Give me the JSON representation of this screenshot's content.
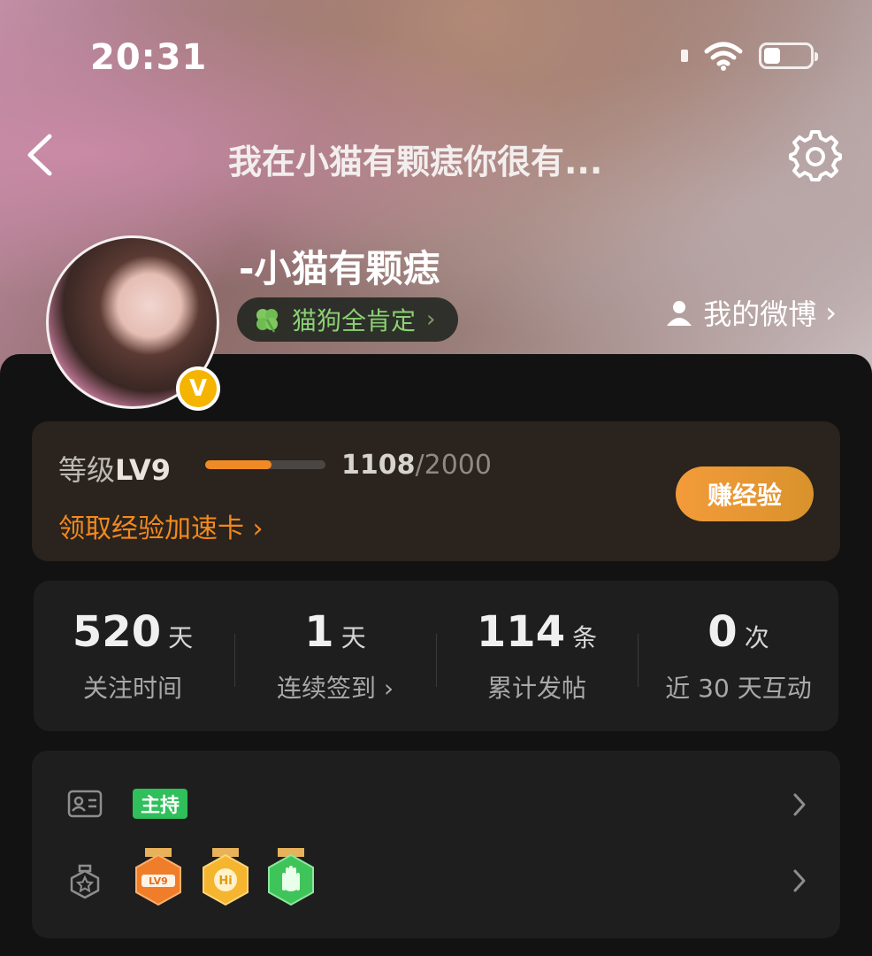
{
  "status_bar": {
    "time": "20:31"
  },
  "header": {
    "title": "我在小猫有颗痣你很有..."
  },
  "profile": {
    "username": "-小猫有颗痣",
    "tag_label": "猫狗全肯定",
    "tag_arrow": "›",
    "weibo_link": "我的微博",
    "weibo_arrow": "›",
    "verified_badge": "V"
  },
  "level": {
    "label_prefix": "等级",
    "level_text": "LV9",
    "current_exp": "1108",
    "max_exp": "/2000",
    "progress_fraction": 0.55,
    "accel_link": "领取经验加速卡 ›",
    "earn_button": "赚经验",
    "accent_color": "#f08a26"
  },
  "stats": [
    {
      "value": "520",
      "unit": "天",
      "label": "关注时间"
    },
    {
      "value": "1",
      "unit": "天",
      "label": "连续签到 ›"
    },
    {
      "value": "114",
      "unit": "条",
      "label": "累计发帖"
    },
    {
      "value": "0",
      "unit": "次",
      "label": "近 30 天互动"
    }
  ],
  "identity": {
    "role_tag": "主持",
    "role_tag_color": "#2fbf5b"
  },
  "medals": [
    {
      "icon": "lv9-medal-icon",
      "text": "LV9",
      "color": "#f07d2a"
    },
    {
      "icon": "hi-medal-icon",
      "text": "Hi",
      "color": "#f5b52f"
    },
    {
      "icon": "hand-medal-icon",
      "text": "",
      "color": "#3fc45a"
    }
  ]
}
